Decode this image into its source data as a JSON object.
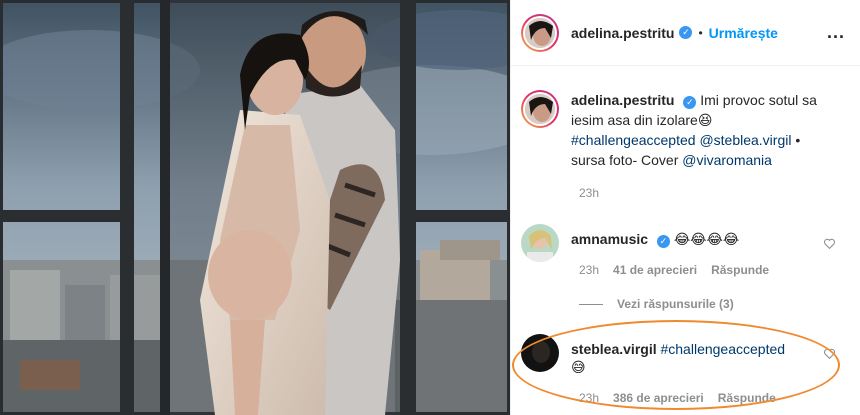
{
  "header": {
    "username": "adelina.pestritu",
    "separator": "•",
    "follow_label": "Urmărește",
    "more_icon": "more-horizontal-icon",
    "more_label": "..."
  },
  "caption": {
    "username": "adelina.pestritu",
    "text_1": "Imi provoc sotul sa iesim asa din izolare",
    "emoji_1": "😆",
    "hashtag": "#challengeaccepted",
    "mention_1": "@steblea.virgil",
    "bullet": "•",
    "text_2": "sursa foto- Cover",
    "mention_2": "@vivaromania",
    "time": "23h"
  },
  "comments": [
    {
      "username": "amnamusic",
      "emojis": "😂😂😂😂",
      "time": "23h",
      "likes": "41 de aprecieri",
      "reply_label": "Răspunde",
      "view_replies": "Vezi răspunsurile (3)"
    },
    {
      "username": "steblea.virgil",
      "hashtag": "#challengeaccepted",
      "emoji": "😅",
      "time": "23h",
      "likes": "386 de aprecieri",
      "reply_label": "Răspunde"
    }
  ],
  "colors": {
    "accent_blue": "#0095f6",
    "annotation_orange": "#f08a2e",
    "link_dark_blue": "#00376b",
    "muted_gray": "#8e8e8e"
  }
}
